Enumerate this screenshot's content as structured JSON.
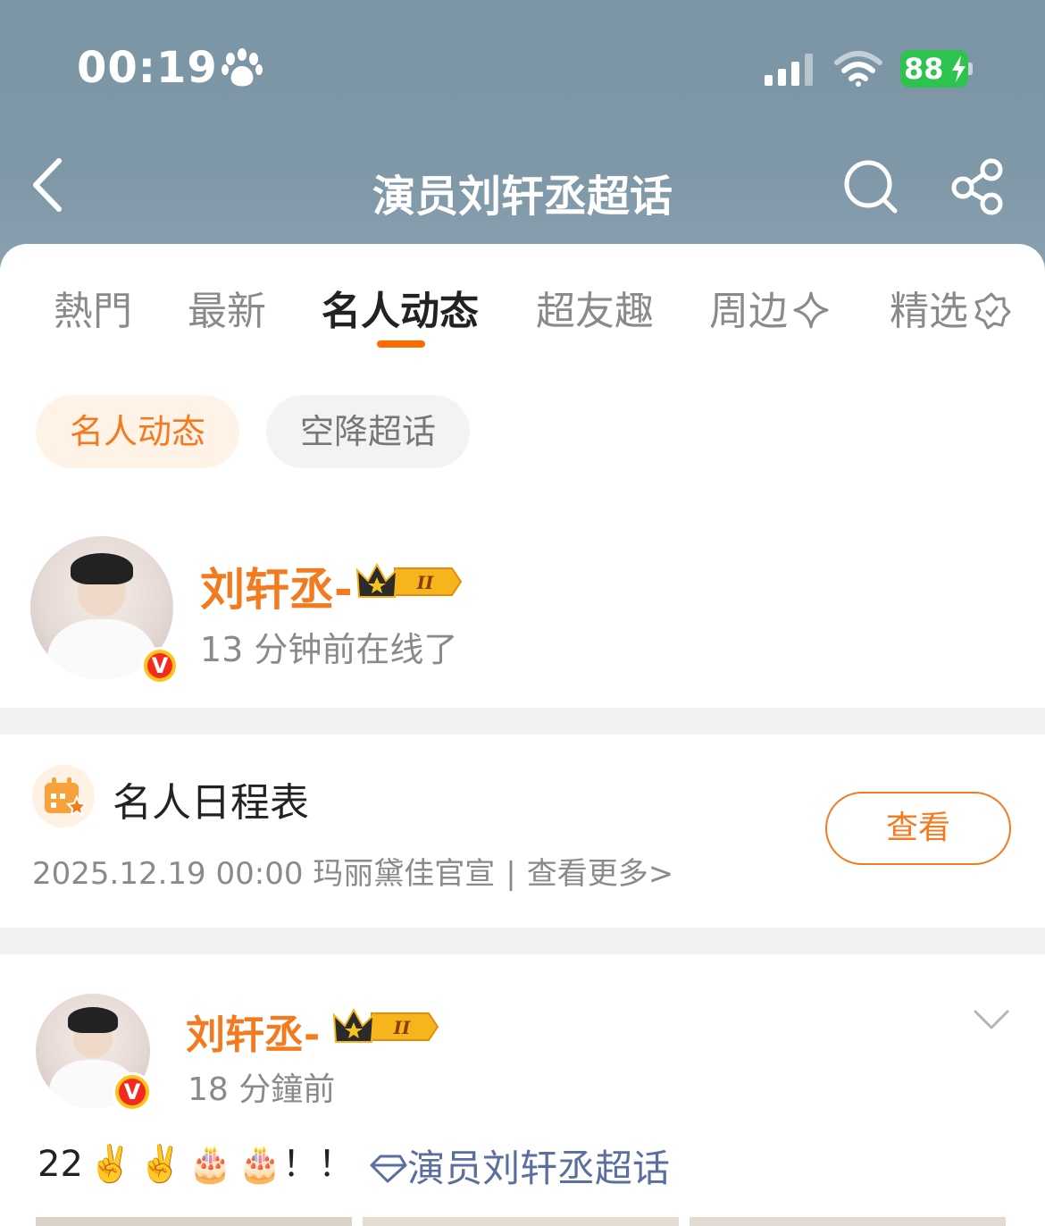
{
  "status_bar": {
    "time": "00:19",
    "battery": "88"
  },
  "nav": {
    "title": "演员刘轩丞超话"
  },
  "tabs": [
    {
      "label": "熱門"
    },
    {
      "label": "最新"
    },
    {
      "label": "名人动态"
    },
    {
      "label": "超友趣"
    },
    {
      "label": "周边"
    },
    {
      "label": "精选"
    }
  ],
  "active_tab": "名人动态",
  "chips": [
    {
      "label": "名人动态"
    },
    {
      "label": "空降超话"
    }
  ],
  "profile": {
    "name": "刘轩丞-",
    "badge_level": "II",
    "last_online": "13 分钟前在线了",
    "verified": "V"
  },
  "schedule": {
    "title": "名人日程表",
    "entry": "2025.12.19 00:00 玛丽黛佳官宣",
    "separator": "|",
    "more": "查看更多>",
    "view_button": "查看"
  },
  "post": {
    "author": "刘轩丞-",
    "badge_level": "II",
    "time": "18 分鐘前",
    "verified": "V",
    "text_prefix": "22",
    "emojis": [
      "✌️",
      "✌️",
      "🎂",
      "🎂"
    ],
    "text_suffix": "！！",
    "topic": "演员刘轩丞超话"
  },
  "colors": {
    "accent": "#f47a1f",
    "tab_indicator": "#ff6a00",
    "topic_link": "#5b6ea0",
    "header_bg": "#7f98a8",
    "battery": "#2ec24f"
  },
  "icons": [
    "paw-icon",
    "signal-icon",
    "wifi-icon",
    "battery-icon",
    "back-icon",
    "search-icon",
    "share-icon",
    "sparkle-icon",
    "badge-star-icon",
    "calendar-icon",
    "crown-icon",
    "chevron-down-icon",
    "diamond-icon"
  ]
}
